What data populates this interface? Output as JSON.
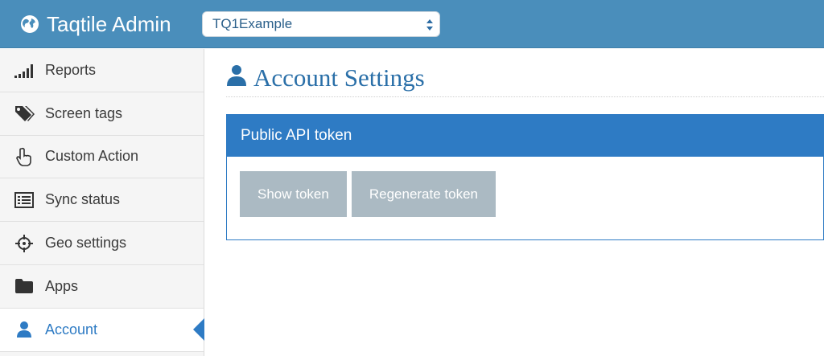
{
  "header": {
    "brand": "Taqtile Admin",
    "brand_icon": "globe-icon",
    "tenant_select": {
      "value": "TQ1Example"
    }
  },
  "sidebar": {
    "items": [
      {
        "label": "Reports",
        "icon": "signal-bars-icon",
        "active": false
      },
      {
        "label": "Screen tags",
        "icon": "tags-icon",
        "active": false
      },
      {
        "label": "Custom Action",
        "icon": "hand-pointer-icon",
        "active": false
      },
      {
        "label": "Sync status",
        "icon": "list-icon",
        "active": false
      },
      {
        "label": "Geo settings",
        "icon": "crosshairs-icon",
        "active": false
      },
      {
        "label": "Apps",
        "icon": "folder-icon",
        "active": false
      },
      {
        "label": "Account",
        "icon": "user-icon",
        "active": true
      }
    ]
  },
  "main": {
    "title": "Account Settings",
    "title_icon": "user-icon",
    "panel": {
      "heading": "Public API token",
      "show_token_label": "Show token",
      "regenerate_token_label": "Regenerate token"
    }
  },
  "colors": {
    "topbar": "#4a8ebb",
    "accent": "#2e7bc4",
    "button": "#abbac3",
    "title": "#2a6fa8"
  }
}
